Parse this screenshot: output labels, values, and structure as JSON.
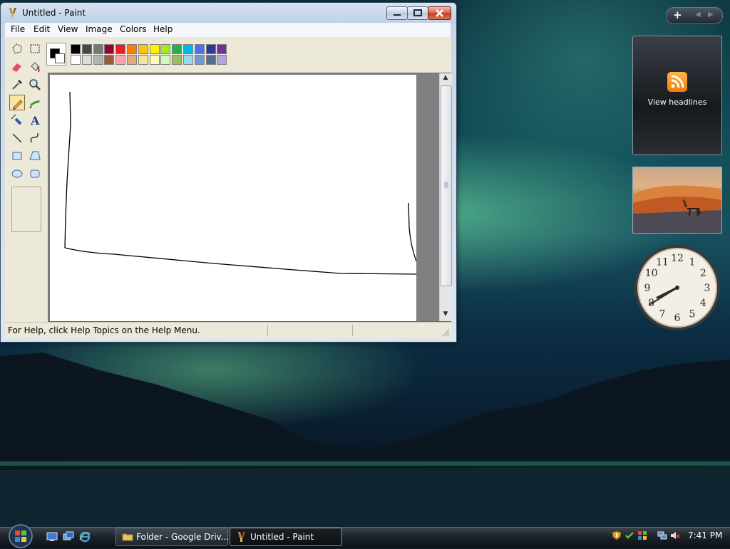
{
  "window": {
    "title": "Untitled - Paint",
    "menu": [
      "File",
      "Edit",
      "View",
      "Image",
      "Colors",
      "Help"
    ],
    "status_text": "For Help, click Help Topics on the Help Menu."
  },
  "toolbox": {
    "tools": [
      {
        "name": "free-form-select-icon"
      },
      {
        "name": "rectangle-select-icon"
      },
      {
        "name": "eraser-icon"
      },
      {
        "name": "fill-bucket-icon"
      },
      {
        "name": "color-picker-icon"
      },
      {
        "name": "magnifier-icon"
      },
      {
        "name": "pencil-icon",
        "selected": true
      },
      {
        "name": "brush-icon"
      },
      {
        "name": "airbrush-icon"
      },
      {
        "name": "text-icon",
        "glyph": "A"
      },
      {
        "name": "line-icon"
      },
      {
        "name": "curve-icon"
      },
      {
        "name": "rectangle-icon"
      },
      {
        "name": "polygon-icon"
      },
      {
        "name": "ellipse-icon"
      },
      {
        "name": "rounded-rectangle-icon"
      }
    ]
  },
  "palette": {
    "foreground": "#000000",
    "background": "#ffffff",
    "row1": [
      "#000000",
      "#464646",
      "#787878",
      "#990030",
      "#ed1c24",
      "#ff7e00",
      "#ffc20e",
      "#fff200",
      "#a8e61d",
      "#22b14c",
      "#00b7ef",
      "#4d6df3",
      "#2f3699",
      "#6f3198"
    ],
    "row2": [
      "#ffffff",
      "#dcdcdc",
      "#b4b4b4",
      "#9c5a3c",
      "#ffa3b1",
      "#e5aa7a",
      "#f5e49c",
      "#fff9bd",
      "#d3f9bc",
      "#9dbb61",
      "#99d9ea",
      "#709ad1",
      "#546d8e",
      "#b5a5d5"
    ]
  },
  "sidebar": {
    "feed_label": "View headlines"
  },
  "taskbar": {
    "tasks": [
      {
        "label": "Folder - Google Driv..."
      },
      {
        "label": "Untitled - Paint"
      }
    ],
    "time": "7:41 PM"
  },
  "clock_numbers": [
    "12",
    "1",
    "2",
    "3",
    "4",
    "5",
    "6",
    "7",
    "8",
    "9",
    "10",
    "11"
  ]
}
